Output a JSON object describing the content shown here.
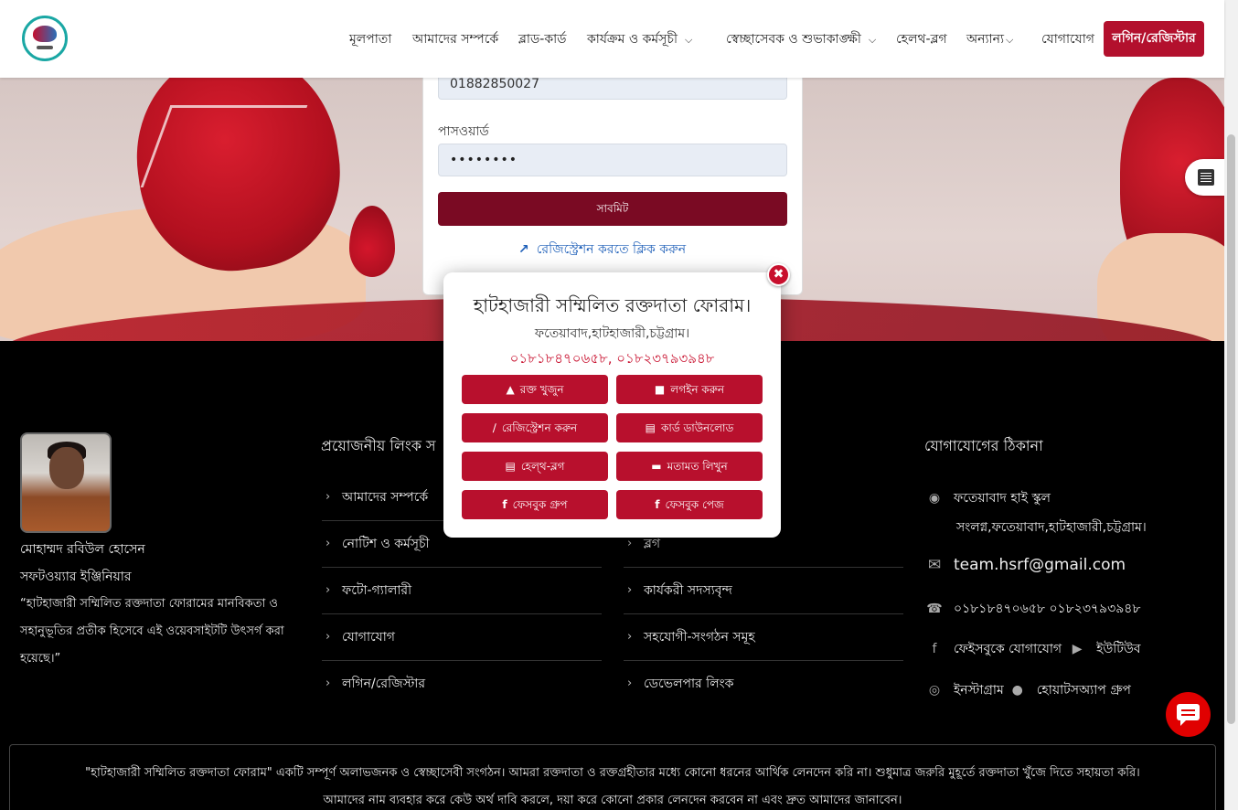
{
  "header": {
    "nav": [
      {
        "label": "মূলপাতা"
      },
      {
        "label": "আমাদের সম্পর্কে"
      },
      {
        "label": "ব্লাড-কার্ড"
      },
      {
        "label": "কার্যক্রম ও কর্মসূচী"
      },
      {
        "label": "স্বেচ্ছাসেবক ও শুভাকাঙ্ক্ষী"
      },
      {
        "label": "হেলথ-ব্লগ"
      },
      {
        "label": "অন্যান্য"
      },
      {
        "label": "যোগাযোগ"
      }
    ],
    "login_label": "লগিন/রেজিস্টার"
  },
  "login_form": {
    "phone_value": "01882850027",
    "password_label": "পাসওয়ার্ড",
    "password_value": "••••••••",
    "submit_label": "সাবমিট",
    "register_link": "রেজিস্ট্রেশন করতে ক্লিক করুন"
  },
  "modal": {
    "title": "হাটহাজারী সম্মিলিত রক্তদাতা ফোরাম।",
    "subtitle": "ফতেয়াবাদ,হাটহাজারী,চট্টগ্রাম।",
    "phones": "০১৮১৮৪৭০৬৫৮, ০১৮২৩৭৯৩৯৪৮",
    "buttons": [
      {
        "label": "রক্ত খুজুন",
        "icon": "blood-drop-icon"
      },
      {
        "label": "লগইন করুন",
        "icon": "lock-icon"
      },
      {
        "label": "রেজিস্ট্রেশন করুন",
        "icon": "syringe-icon"
      },
      {
        "label": "কার্ড ডাউনলোড",
        "icon": "id-card-icon"
      },
      {
        "label": "হেল্থ-ব্লগ",
        "icon": "newspaper-icon"
      },
      {
        "label": "মতামত লিখুন",
        "icon": "comment-icon"
      },
      {
        "label": "ফেসবুক গ্রুপ",
        "icon": "facebook-icon"
      },
      {
        "label": "ফেসবুক পেজ",
        "icon": "facebook-icon"
      }
    ]
  },
  "footer": {
    "profile": {
      "name": "মোহাম্মদ রবিউল হোসেন",
      "role": "সফটওয়্যার ইঞ্জিনিয়ার",
      "quote": "“হাটহাজারী সম্মিলিত রক্তদাতা ফোরামের মানবিকতা ও সহানুভূতির প্রতীক হিসেবে এই ওয়েবসাইটটি উৎসর্গ করা হয়েছে।”"
    },
    "links_title": "প্রয়োজনীয় লিংক স",
    "links_col1": [
      "আমাদের সম্পর্কে",
      "নোটিশ ও কর্মসূচী",
      "ফটো-গ্যালারী",
      "যোগাযোগ",
      "লগিন/রেজিস্টার"
    ],
    "links_col2": [
      "ব্লগ",
      "কার্যকরী সদস্যবৃন্দ",
      "সহযোগী-সংগঠন সমূহ",
      "ডেভেলপার লিংক"
    ],
    "contact_title": "যোগাযোগের ঠিকানা",
    "address_line1": "ফতেয়াবাদ হাই স্কুল",
    "address_line2": "সংলগ্ন,ফতেয়াবাদ,হাটহাজারী,চট্টগ্রাম।",
    "email": "team.hsrf@gmail.com",
    "phones": "০১৮১৮৪৭০৬৫৮ ০১৮২৩৭৯৩৯৪৮",
    "facebook": "ফেইসবুকে যোগাযোগ",
    "youtube": "ইউটিউব",
    "instagram": "ইনস্টাগ্রাম",
    "whatsapp": "হোয়াটসঅ্যাপ গ্রুপ",
    "disclaimer_line1": "\"হাটহাজারী সম্মিলিত রক্তদাতা ফোরাম\" একটি সম্পূর্ণ অলাভজনক ও স্বেচ্ছাসেবী সংগঠন। আমরা রক্তদাতা ও রক্তগ্রহীতার মধ্যে কোনো ধরনের আর্থিক লেনদেন করি না। শুধুমাত্র জরুরি মুহূর্তে রক্তদাতা খুঁজে দিতে সহায়তা করি।",
    "disclaimer_line2": "আমাদের নাম ব্যবহার করে কেউ অর্থ দাবি করলে, দয়া করে কোনো প্রকার লেনদেন করবেন না এবং দ্রুত আমাদের জানাবেন।"
  },
  "colors": {
    "brand": "#b3102d",
    "submit": "#7a0a23",
    "link": "#1e5fb8"
  }
}
